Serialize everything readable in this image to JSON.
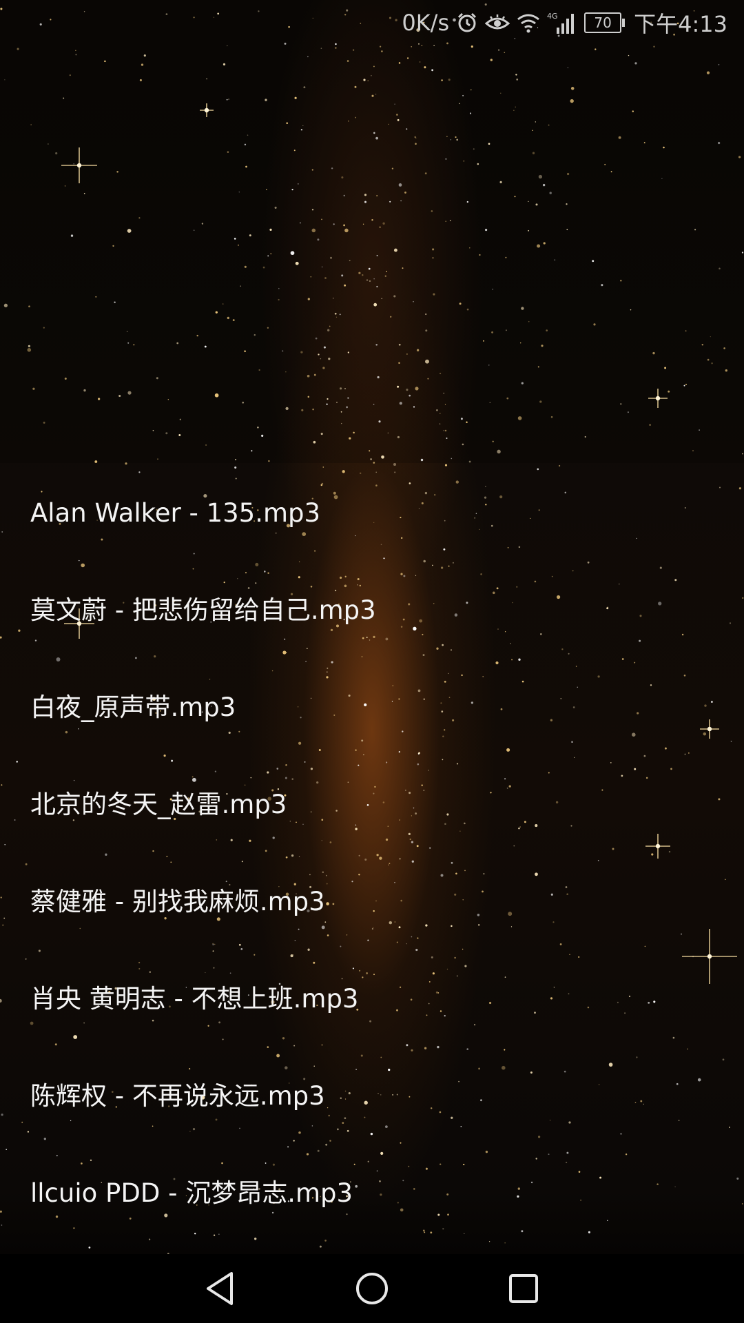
{
  "status_bar": {
    "net_speed": "0K/s",
    "network_type": "4G",
    "battery_level": "70",
    "time": "下午4:13",
    "icons": [
      "alarm-icon",
      "eye-icon",
      "wifi-icon",
      "signal-icon",
      "battery-icon"
    ]
  },
  "songs": [
    "Alan Walker - 135.mp3",
    "莫文蔚 - 把悲伤留给自己.mp3",
    "白夜_原声带.mp3",
    "北京的冬天_赵雷.mp3",
    "蔡健雅 - 别找我麻烦.mp3",
    "肖央 黄明志 - 不想上班.mp3",
    "陈辉权 - 不再说永远.mp3",
    "llcuio PDD - 沉梦昂志.mp3"
  ],
  "nav_bar": {
    "icons": [
      "back-icon",
      "home-icon",
      "recents-icon"
    ]
  },
  "colors": {
    "text": "#f4f4f4",
    "status_text": "#cfcfcf",
    "nav_icon": "#e8e8e8",
    "glow": "#8c4614"
  }
}
